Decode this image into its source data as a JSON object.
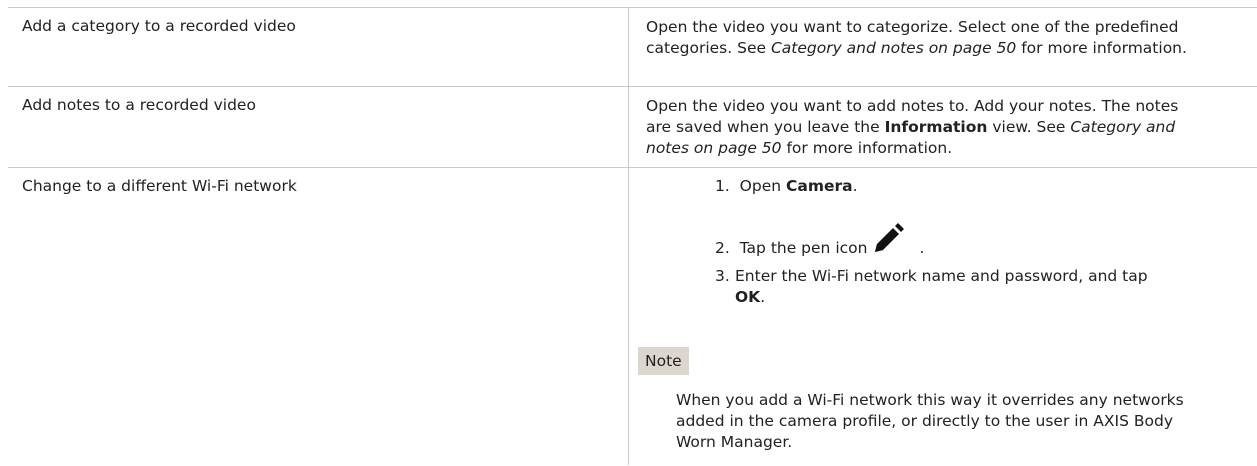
{
  "rows": [
    {
      "task": "Add a category to a recorded video",
      "desc_a": "Open the video you want to categorize. Select one of the predefined categories. See ",
      "desc_ref": "Category and notes on page 50",
      "desc_b": " for more information."
    },
    {
      "task": "Add notes to a recorded video",
      "desc_a": "Open the video you want to add notes to. Add your notes. The notes are saved when you leave the ",
      "desc_bold": "Information",
      "desc_b": " view. See ",
      "desc_ref": "Category and notes on page 50",
      "desc_c": " for more information."
    },
    {
      "task": "Change to a different Wi-Fi network",
      "steps": [
        {
          "num": "1.",
          "pre": "Open ",
          "bold": "Camera",
          "post": "."
        },
        {
          "num": "2.",
          "pre": "Tap the pen icon",
          "post": "."
        },
        {
          "num": "3.",
          "pre": "Enter the Wi-Fi network name and password, and tap ",
          "bold": "OK",
          "post": "."
        }
      ],
      "note_label": "Note",
      "note_text": "When you add a Wi-Fi network this way it overrides any networks added in the camera profile, or directly to the user in AXIS Body Worn Manager."
    }
  ],
  "icons": {
    "pen": "pen-icon"
  }
}
